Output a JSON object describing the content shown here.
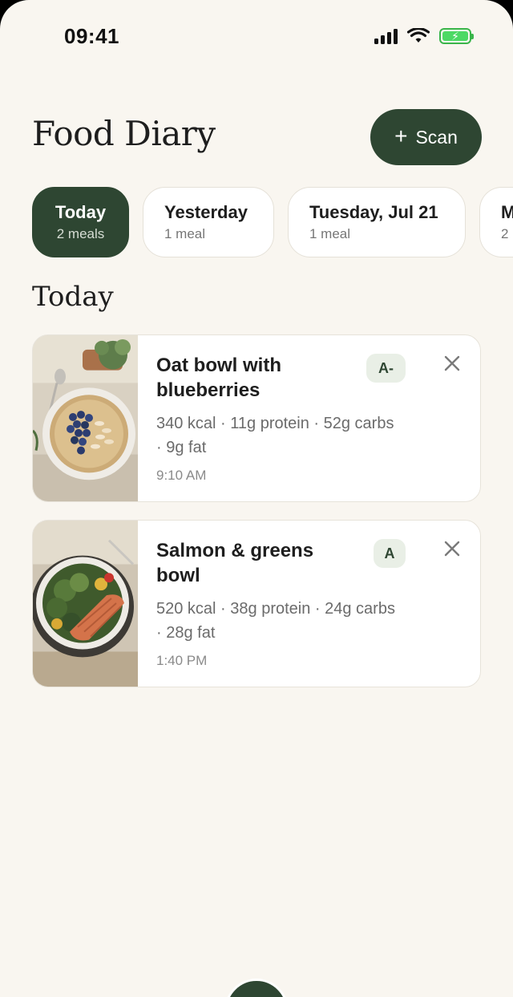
{
  "status_bar": {
    "time": "09:41",
    "icons": [
      "cellular-signal-icon",
      "wifi-icon",
      "battery-charging-icon"
    ]
  },
  "header": {
    "title": "Food Diary",
    "scan_button": {
      "icon": "plus-icon",
      "label": "Scan"
    }
  },
  "day_tabs": [
    {
      "label": "Today",
      "count": "2 meals",
      "active": true
    },
    {
      "label": "Yesterday",
      "count": "1 meal",
      "active": false
    },
    {
      "label": "Tuesday, Jul 21",
      "count": "1 meal",
      "active": false
    },
    {
      "label": "M",
      "count": "2",
      "active": false
    }
  ],
  "section_title": "Today",
  "meals": [
    {
      "name": "Oat bowl with blueberries",
      "macros": "340 kcal · 11g protein · 52g carbs · 9g fat",
      "time": "9:10 AM",
      "grade": "A-",
      "photo": "oat-bowl-photo"
    },
    {
      "name": "Salmon & greens bowl",
      "macros": "520 kcal · 38g protein · 24g carbs · 28g fat",
      "time": "1:40 PM",
      "grade": "A",
      "photo": "salmon-bowl-photo"
    }
  ],
  "colors": {
    "background": "#f9f6f0",
    "accent": "#2e4632",
    "badge_background": "#e9efe6",
    "card_background": "#ffffff",
    "battery": "#4cd964"
  }
}
